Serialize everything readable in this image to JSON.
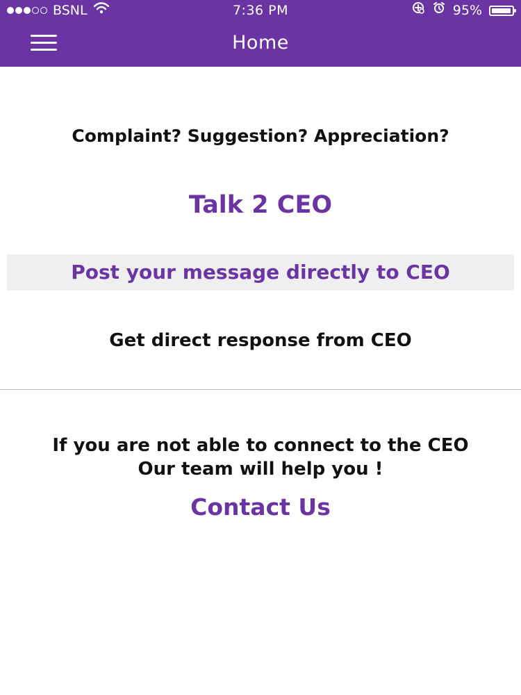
{
  "status_bar": {
    "carrier": "BSNL",
    "time": "7:36 PM",
    "battery": "95%",
    "battery_level": 95,
    "signal_bars": 3,
    "signal_total": 5,
    "icons": [
      "wifi-icon",
      "location-lock-icon",
      "alarm-icon",
      "battery-icon"
    ]
  },
  "header": {
    "title": "Home",
    "menu_icon": "hamburger-menu-icon"
  },
  "main": {
    "prompt": "Complaint? Suggestion? Appreciation?",
    "brand_title": "Talk 2 CEO",
    "post_button_label": "Post your message directly to CEO",
    "response_text": "Get direct response from CEO",
    "help_line_1": "If you are not able to connect to the CEO",
    "help_line_2": "Our team will help you !",
    "contact_label": "Contact Us"
  },
  "colors": {
    "accent": "#6a35a2",
    "button_background": "#efeff1",
    "text": "#111111",
    "divider": "#bdbdbd"
  }
}
